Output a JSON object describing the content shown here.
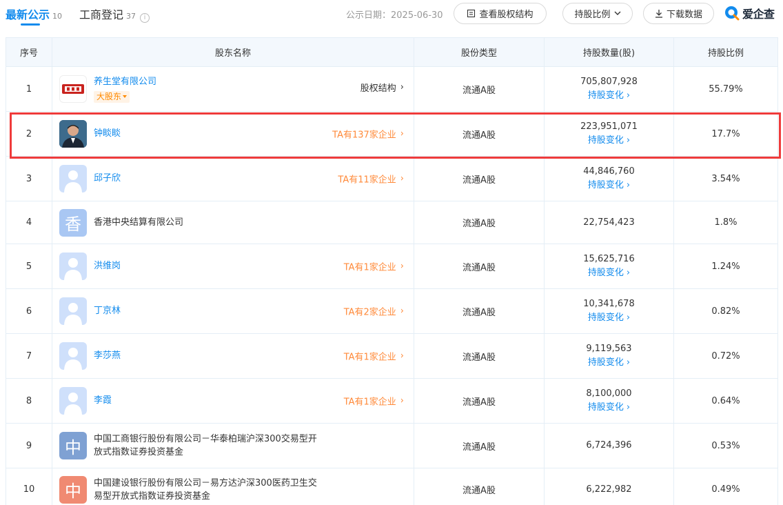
{
  "tabs": [
    {
      "label": "最新公示",
      "count": "10"
    },
    {
      "label": "工商登记",
      "count": "37"
    }
  ],
  "info_icon": "i",
  "publish_date": "公示日期：2025-06-30",
  "buttons": {
    "equity_structure": "查看股权结构",
    "ratio_dropdown": "持股比例",
    "download": "下载数据"
  },
  "brand": {
    "name": "爱企查"
  },
  "columns": [
    "序号",
    "股东名称",
    "股份类型",
    "持股数量(股)",
    "持股比例"
  ],
  "change_label": "持股变化",
  "rows": [
    {
      "idx": "1",
      "name": "养生堂有限公司",
      "tag": "大股东",
      "right": "股权结构",
      "type": "流通A股",
      "qty": "705,807,928",
      "ratio": "55.79%"
    },
    {
      "idx": "2",
      "name": "钟睒睒",
      "right": "TA有137家企业",
      "type": "流通A股",
      "qty": "223,951,071",
      "ratio": "17.7%"
    },
    {
      "idx": "3",
      "name": "邱子欣",
      "right": "TA有11家企业",
      "type": "流通A股",
      "qty": "44,846,760",
      "ratio": "3.54%"
    },
    {
      "idx": "4",
      "name": "香港中央结算有限公司",
      "avatar_char": "香",
      "type": "流通A股",
      "qty": "22,754,423",
      "ratio": "1.8%"
    },
    {
      "idx": "5",
      "name": "洪维岗",
      "right": "TA有1家企业",
      "type": "流通A股",
      "qty": "15,625,716",
      "ratio": "1.24%"
    },
    {
      "idx": "6",
      "name": "丁京林",
      "right": "TA有2家企业",
      "type": "流通A股",
      "qty": "10,341,678",
      "ratio": "0.82%"
    },
    {
      "idx": "7",
      "name": "李莎燕",
      "right": "TA有1家企业",
      "type": "流通A股",
      "qty": "9,119,563",
      "ratio": "0.72%"
    },
    {
      "idx": "8",
      "name": "李霞",
      "right": "TA有1家企业",
      "type": "流通A股",
      "qty": "8,100,000",
      "ratio": "0.64%"
    },
    {
      "idx": "9",
      "name": "中国工商银行股份有限公司－华泰柏瑞沪深300交易型开放式指数证券投资基金",
      "avatar_char": "中",
      "type": "流通A股",
      "qty": "6,724,396",
      "ratio": "0.53%"
    },
    {
      "idx": "10",
      "name": "中国建设银行股份有限公司－易方达沪深300医药卫生交易型开放式指数证券投资基金",
      "avatar_char": "中",
      "type": "流通A股",
      "qty": "6,222,982",
      "ratio": "0.49%"
    }
  ],
  "colors": {
    "accent": "#128bed",
    "orange": "#ff8a3a",
    "highlight": "#ef3b3b",
    "avatar_hk": "#a9c7f3",
    "avatar_icbc": "#7fa1d3",
    "avatar_ccb": "#f08a72"
  }
}
